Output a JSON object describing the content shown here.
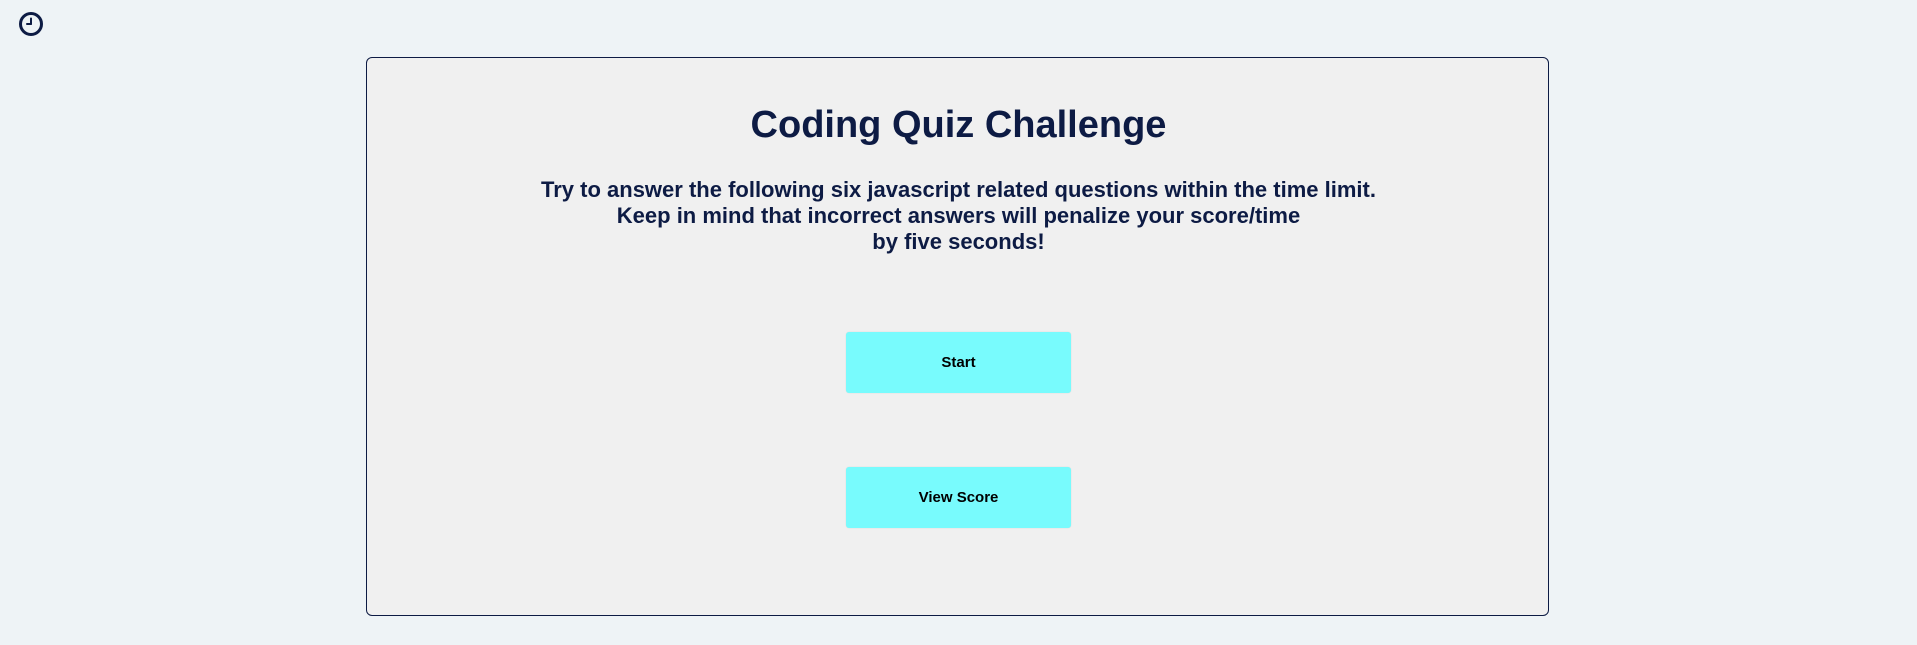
{
  "header": {
    "timer_icon": "clock-icon"
  },
  "quiz": {
    "title": "Coding Quiz Challenge",
    "description_lines": [
      "Try to answer the following six javascript related questions within the time limit.",
      "Keep in mind that incorrect answers will penalize your score/time",
      "by five seconds!"
    ],
    "start_label": "Start",
    "view_score_label": "View Score"
  },
  "colors": {
    "background": "#eef3f6",
    "card": "#f0f0f0",
    "text": "#0d1b44",
    "button": "#78fbfd"
  }
}
